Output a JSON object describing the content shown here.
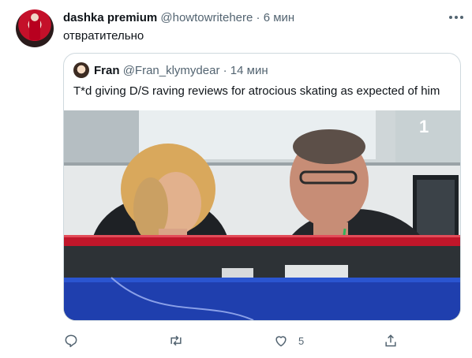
{
  "tweet": {
    "author_name": "dashka premium",
    "author_handle": "@howtowritehere",
    "separator": "·",
    "time": "6 мин",
    "text": "отвратительно",
    "avatar_icon": "user-avatar-icon",
    "more_icon": "more-dots-icon"
  },
  "quote": {
    "author_name": "Fran",
    "author_handle": "@Fran_klymydear",
    "separator": "·",
    "time": "14 мин",
    "text": "T*d giving D/S raving reviews for atrocious skating as expected of him",
    "media_description_icon": "photo-commentators"
  },
  "actions": {
    "reply_icon": "reply-icon",
    "retweet_icon": "retweet-icon",
    "like_icon": "like-icon",
    "like_count": "5",
    "share_icon": "share-icon"
  },
  "colors": {
    "text": "#0f1419",
    "secondary": "#536471",
    "border": "#cfd9de"
  }
}
